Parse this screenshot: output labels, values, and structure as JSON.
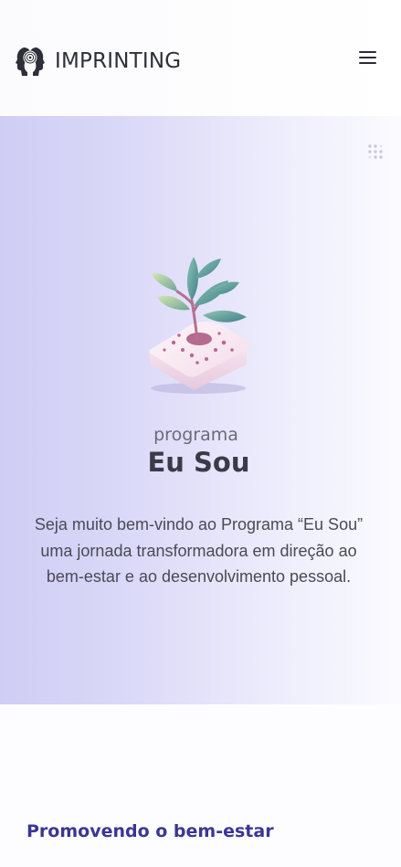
{
  "header": {
    "brand_name": "IMPRINTING",
    "logo_icon": "head-profiles-logo-icon",
    "menu_icon": "hamburger-menu-icon"
  },
  "hero": {
    "decor_icon": "dot-grid-icon",
    "illustration": "plant-sprout-illustration",
    "eyebrow": "programa",
    "title": "Eu Sou",
    "description": "Seja muito bem-vindo ao Programa “Eu Sou” uma jornada transformadora em direção ao bem-estar e ao desenvolvimento pessoal."
  },
  "sections": {
    "wellbeing_title": "Promovendo o bem-estar"
  },
  "colors": {
    "hero_gradient_start": "#cfcdf4",
    "hero_gradient_end": "#fbfbff",
    "title_text": "#3b3a48",
    "section_title": "#3b3694"
  }
}
